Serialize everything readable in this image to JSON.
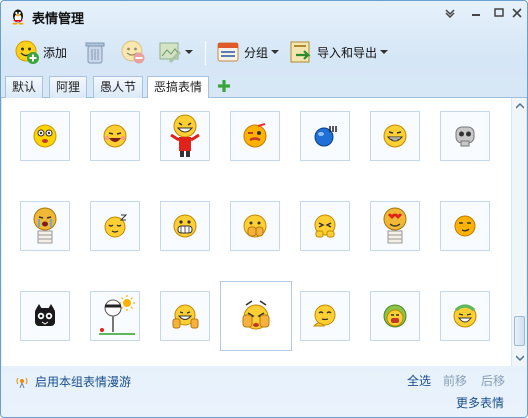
{
  "window": {
    "title": "表情管理"
  },
  "toolbar": {
    "add_label": "添加",
    "group_label": "分组",
    "import_export_label": "导入和导出"
  },
  "tabs": [
    {
      "label": "默认",
      "active": false
    },
    {
      "label": "阿狸",
      "active": false
    },
    {
      "label": "愚人节",
      "active": false
    },
    {
      "label": "恶搞表情",
      "active": true
    }
  ],
  "emoticons": [
    "yellow-face",
    "laughing-face",
    "ghost-flailing",
    "winking-red-face",
    "blue-ball",
    "grinning-face",
    "grey-skull",
    "crying-bandaged",
    "sleepy-face",
    "big-grin",
    "hand-over-face",
    "squinting-face",
    "heart-eyes-bandaged",
    "smirking-face",
    "black-creature",
    "sunny-pole",
    "thumbs-up-face",
    "facepalm-selected",
    "shy-face",
    "green-mouth-face",
    "green-laughing-face"
  ],
  "footer": {
    "roam_label": "启用本组表情漫游",
    "select_all": "全选",
    "move_forward": "前移",
    "move_backward": "后移",
    "more": "更多表情"
  },
  "colors": {
    "accent": "#1a4f8c",
    "border": "#6a9fd0"
  }
}
